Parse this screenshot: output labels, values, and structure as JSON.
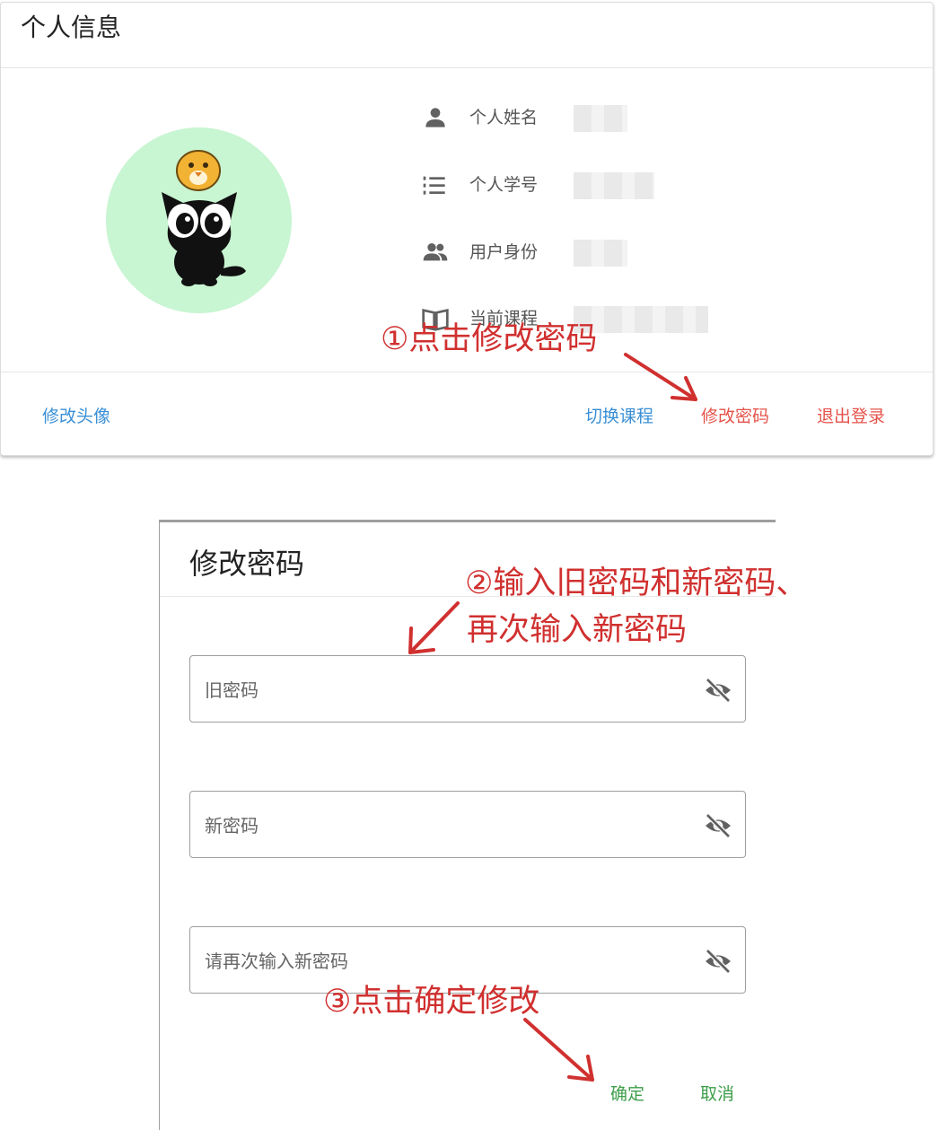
{
  "profile_card": {
    "title": "个人信息",
    "fields": [
      {
        "icon": "person-icon",
        "label": "个人姓名"
      },
      {
        "icon": "numbered-list-icon",
        "label": "个人学号"
      },
      {
        "icon": "people-icon",
        "label": "用户身份"
      },
      {
        "icon": "book-icon",
        "label": "当前课程"
      }
    ],
    "actions": {
      "change_avatar": "修改头像",
      "switch_course": "切换课程",
      "change_password": "修改密码",
      "logout": "退出登录"
    }
  },
  "password_dialog": {
    "title": "修改密码",
    "fields": [
      {
        "placeholder": "旧密码",
        "icon": "eye-off-icon"
      },
      {
        "placeholder": "新密码",
        "icon": "eye-off-icon"
      },
      {
        "placeholder": "请再次输入新密码",
        "icon": "eye-off-icon"
      }
    ],
    "confirm_label": "确定",
    "cancel_label": "取消"
  },
  "annotations": {
    "step1": "①点击修改密码",
    "step2_line1": "②输入旧密码和新密码、",
    "step2_line2": "再次输入新密码",
    "step3": "③点击确定修改"
  },
  "colors": {
    "primary_link": "#3a8fd6",
    "danger_link": "#e5534b",
    "dialog_button": "#3d9e4a",
    "annotation": "#d0302f",
    "avatar_bg": "#c8f5d2",
    "icon_gray": "#616161"
  }
}
